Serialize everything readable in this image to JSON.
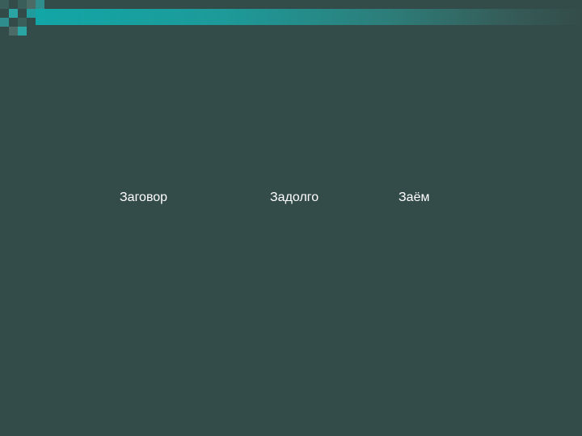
{
  "slide": {
    "words": [
      "Заговор",
      "Задолго",
      "Заём"
    ],
    "colors": {
      "background": "#344c49",
      "accent": "#12a6a6",
      "text": "#ffffff"
    }
  }
}
